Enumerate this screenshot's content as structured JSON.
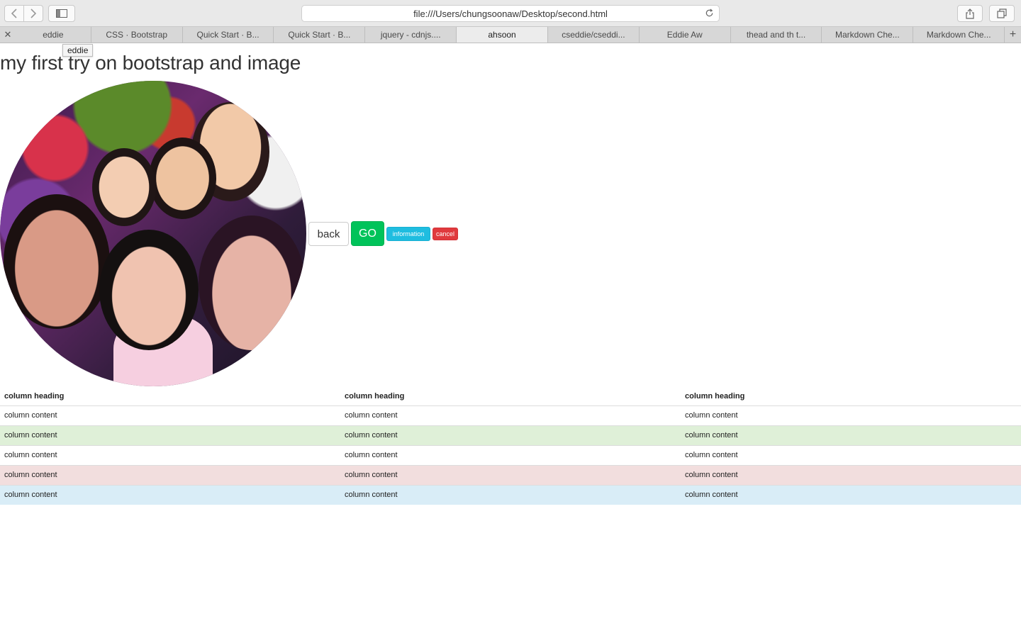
{
  "browser": {
    "url": "file:///Users/chungsoonaw/Desktop/second.html",
    "tabs": [
      {
        "label": "eddie",
        "active": false
      },
      {
        "label": "CSS · Bootstrap",
        "active": false
      },
      {
        "label": "Quick Start · B...",
        "active": false
      },
      {
        "label": "Quick Start · B...",
        "active": false
      },
      {
        "label": "jquery - cdnjs....",
        "active": false
      },
      {
        "label": "ahsoon",
        "active": true
      },
      {
        "label": "cseddie/cseddi...",
        "active": false
      },
      {
        "label": "Eddie Aw",
        "active": false
      },
      {
        "label": "thead and th t...",
        "active": false
      },
      {
        "label": "Markdown Che...",
        "active": false
      },
      {
        "label": "Markdown Che...",
        "active": false
      }
    ],
    "tooltip": "eddie"
  },
  "page": {
    "title": "my first try on bootstrap and image",
    "buttons": {
      "back": "back",
      "go": "GO",
      "information": "information",
      "cancel": "cancel"
    },
    "table": {
      "headers": [
        "column heading",
        "column heading",
        "column heading"
      ],
      "rows": [
        {
          "style": "default",
          "cells": [
            "column content",
            "column content",
            "column content"
          ]
        },
        {
          "style": "success",
          "cells": [
            "column content",
            "column content",
            "column content"
          ]
        },
        {
          "style": "default",
          "cells": [
            "column content",
            "column content",
            "column content"
          ]
        },
        {
          "style": "danger",
          "cells": [
            "column content",
            "column content",
            "column content"
          ]
        },
        {
          "style": "info",
          "cells": [
            "column content",
            "column content",
            "column content"
          ]
        }
      ]
    }
  },
  "colors": {
    "go": "#00c35a",
    "info": "#1fbde0",
    "cancel": "#e03a3e",
    "row_success": "#dff0d8",
    "row_danger": "#f2dede",
    "row_info": "#d9edf7"
  }
}
